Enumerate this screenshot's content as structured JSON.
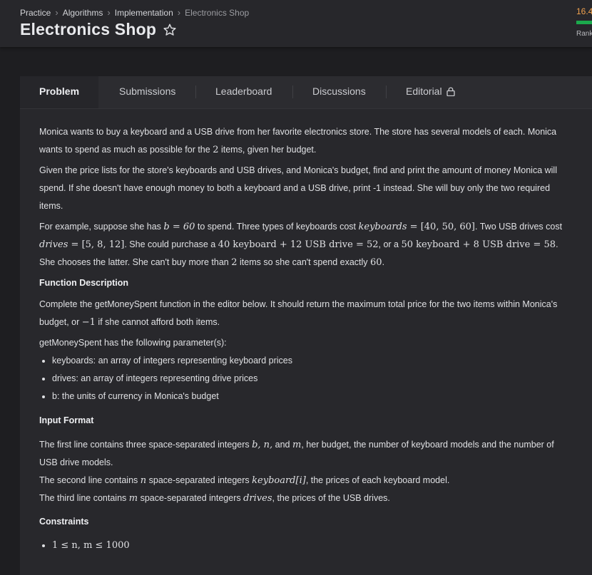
{
  "header": {
    "breadcrumb": [
      "Practice",
      "Algorithms",
      "Implementation",
      "Electronics Shop"
    ],
    "title": "Electronics Shop",
    "score": "16.4",
    "rank_label": "Rank"
  },
  "tabs": [
    "Problem",
    "Submissions",
    "Leaderboard",
    "Discussions",
    "Editorial"
  ],
  "problem": {
    "p1a": "Monica wants to buy a keyboard and a USB drive from her favorite electronics store. The store has several models of each. Monica wants to spend as much as possible for the ",
    "p1_num": "2",
    "p1b": " items, given her budget.",
    "p2": "Given the price lists for the store's keyboards and USB drives, and Monica's budget, find and print the amount of money Monica will spend. If she doesn't have enough money to both a keyboard and a USB drive, print -1 instead. She will buy only the two required items.",
    "ex_a": "For example, suppose she has ",
    "ex_b_math": "b = 60",
    "ex_c": " to spend. Three types of keyboards cost ",
    "ex_keyboards_var": "keyboards",
    "ex_keyboards_val": " = [40, 50, 60]",
    "ex_d": ". Two USB drives cost ",
    "ex_drives_var": "drives",
    "ex_drives_val": " = [5, 8, 12]",
    "ex_e": ". She could purchase a ",
    "ex_opt1": "40 keyboard + 12 USB drive = 52",
    "ex_f": ", or a ",
    "ex_opt2": "50 keyboard + 8 USB drive = 58",
    "ex_g": ". She chooses the latter. She can't buy more than ",
    "ex_two": "2",
    "ex_h": " items so she can't spend exactly ",
    "ex_sixty": "60",
    "ex_i": ".",
    "func_heading": "Function Description",
    "func_a": "Complete the getMoneySpent function in the editor below. It should return the maximum total price for the two items within Monica's budget, or ",
    "func_neg": "−1",
    "func_b": " if she cannot afford both items.",
    "params_intro": "getMoneySpent has the following parameter(s):",
    "params": [
      "keyboards: an array of integers representing keyboard prices",
      "drives: an array of integers representing drive prices",
      "b: the units of currency in Monica's budget"
    ],
    "input_heading": "Input Format",
    "in1_a": "The first line contains three space-separated integers ",
    "in1_vars": "b, n,",
    "in1_and": " and ",
    "in1_m": "m",
    "in1_b": ", her budget, the number of keyboard models and the number of USB drive models.",
    "in2_a": "The second line contains ",
    "in2_n": "n",
    "in2_b": " space-separated integers ",
    "in2_var": "keyboard[i]",
    "in2_c": ", the prices of each keyboard model.",
    "in3_a": "The third line contains ",
    "in3_m": "m",
    "in3_b": " space-separated integers ",
    "in3_var": "drives",
    "in3_c": ", the prices of the USB drives.",
    "constraints_heading": "Constraints",
    "constraint1": "1 ≤ n, m ≤ 1000"
  },
  "colors": {
    "score": "#f0a14e",
    "progress": "#1ba94c",
    "background": "#1e1e21"
  }
}
